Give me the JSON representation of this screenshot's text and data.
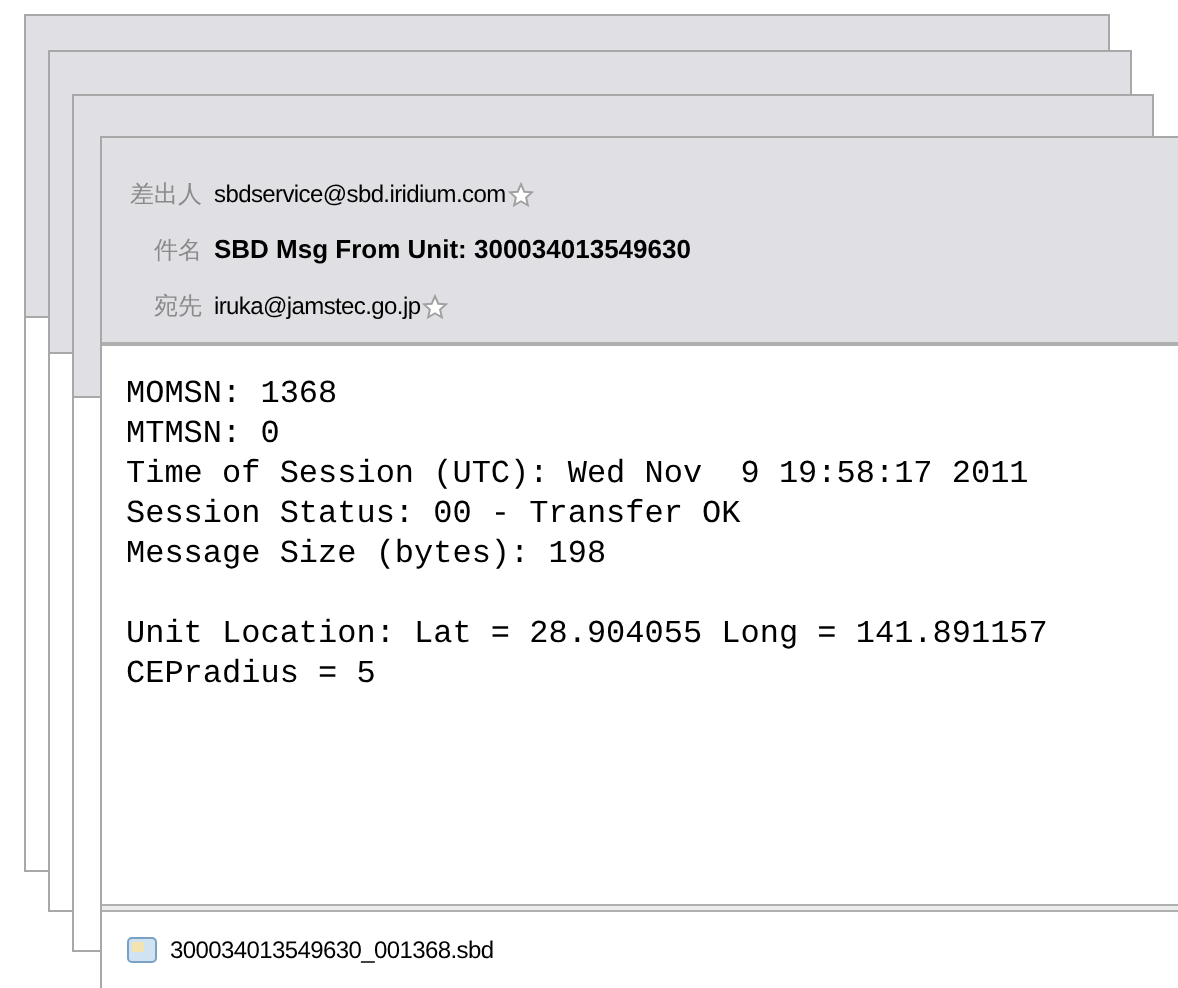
{
  "header": [
    {
      "kind": "address",
      "label": "差出人",
      "value": "sbdservice@sbd.iridium.com"
    },
    {
      "kind": "subject",
      "label": "件名",
      "value": "SBD Msg From Unit: 300034013549630"
    },
    {
      "kind": "address",
      "label": "宛先",
      "value": "iruka@jamstec.go.jp"
    }
  ],
  "body": [
    [
      "MOMSN: 1368",
      "MTMSN: 0",
      "Time of Session (UTC): Wed Nov  9 19:58:17 2011",
      "Session Status: 00 - Transfer OK",
      "Message Size (bytes): 198"
    ],
    [
      "Unit Location: Lat = 28.904055 Long = 141.891157",
      "CEPradius = 5"
    ]
  ],
  "attachment": {
    "name": "300034013549630_001368.sbd"
  }
}
